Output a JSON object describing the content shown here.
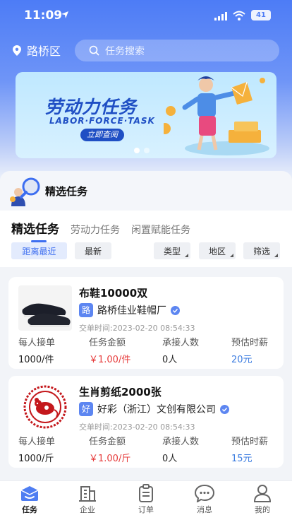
{
  "status_bar": {
    "time": "11:09",
    "battery": "41"
  },
  "header": {
    "location": "路桥区",
    "search_placeholder": "任务搜索"
  },
  "banner": {
    "title": "劳动力任务",
    "subtitle": "LABOR·FORCE·TASK",
    "button": "立即查阅"
  },
  "section_title": "精选任务",
  "tabs": [
    {
      "label": "精选任务",
      "active": true
    },
    {
      "label": "劳动力任务",
      "active": false
    },
    {
      "label": "闲置赋能任务",
      "active": false
    }
  ],
  "filters": {
    "nearest": "距离最近",
    "latest": "最新",
    "type": "类型",
    "region": "地区",
    "filter": "筛选"
  },
  "tasks": [
    {
      "name": "布鞋10000双",
      "badge": "路",
      "company": "路桥佳业鞋帽厂",
      "time": "交单时间:2023-02-20 08:54:33",
      "labels": {
        "per_person": "每人接单",
        "amount": "任务金额",
        "takers": "承接人数",
        "salary": "预估时薪"
      },
      "values": {
        "per_person": "1000/件",
        "amount": "￥1.00/件",
        "takers": "0人",
        "salary": "20元"
      }
    },
    {
      "name": "生肖剪纸2000张",
      "badge": "好",
      "company": "好彩（浙江）文创有限公司",
      "time": "交单时间:2023-02-20 08:54:33",
      "labels": {
        "per_person": "每人接单",
        "amount": "任务金额",
        "takers": "承接人数",
        "salary": "预估时薪"
      },
      "values": {
        "per_person": "1000/斤",
        "amount": "￥1.00/斤",
        "takers": "0人",
        "salary": "15元"
      }
    }
  ],
  "nav": [
    {
      "label": "任务",
      "icon": "task-icon",
      "active": true
    },
    {
      "label": "企业",
      "icon": "building-icon",
      "active": false
    },
    {
      "label": "订单",
      "icon": "clipboard-icon",
      "active": false
    },
    {
      "label": "消息",
      "icon": "chat-icon",
      "active": false
    },
    {
      "label": "我的",
      "icon": "user-icon",
      "active": false
    }
  ],
  "colors": {
    "primary": "#3d6ef0",
    "price": "#e63b3b",
    "salary": "#3d7de0"
  }
}
